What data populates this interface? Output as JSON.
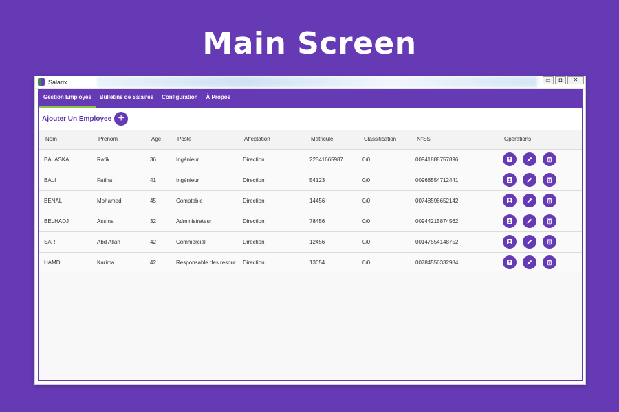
{
  "hero": {
    "title": "Main Screen"
  },
  "window": {
    "title": "Salarix",
    "controls": {
      "minimize": "▭",
      "restore": "◘",
      "close": "✕"
    }
  },
  "nav": {
    "tabs": [
      {
        "label": "Gestion Employés",
        "active": true
      },
      {
        "label": "Bulletins de Salaires",
        "active": false
      },
      {
        "label": "Configuration",
        "active": false
      },
      {
        "label": "À Propos",
        "active": false
      }
    ]
  },
  "toolbar": {
    "add_label": "Ajouter Un Employee",
    "add_icon": "+"
  },
  "table": {
    "columns": [
      "Nom",
      "Prénom",
      "Age",
      "Poste",
      "Affectation",
      "Matricule",
      "Classification",
      "N°SS",
      "Opérations"
    ],
    "rows": [
      [
        "BALASKA",
        "Rafik",
        "36",
        "Ingénieur",
        "Direction",
        "22541665987",
        "0/0",
        "00941888757896"
      ],
      [
        "BALI",
        "Fatiha",
        "41",
        "Ingénieur",
        "Direction",
        "54123",
        "0/0",
        "00968554712441"
      ],
      [
        "BENALI",
        "Mohamed",
        "45",
        "Comptable",
        "Direction",
        "14456",
        "0/0",
        "00748598652142"
      ],
      [
        "BELHADJ",
        "Assma",
        "32",
        "Administrateur",
        "Direction",
        "78456",
        "0/0",
        "00944215874562"
      ],
      [
        "SARI",
        "Abd Allah",
        "42",
        "Commercial",
        "Direction",
        "12456",
        "0/0",
        "00147554148752"
      ],
      [
        "HAMDI",
        "Karima",
        "42",
        "Responsable des resour",
        "Direction",
        "13654",
        "0/0",
        "00784556332984"
      ]
    ],
    "operation_icons": [
      "profile-icon",
      "edit-icon",
      "delete-icon"
    ]
  },
  "colors": {
    "accent": "#663ab4",
    "active_tab_underline": "#8bc34a"
  }
}
